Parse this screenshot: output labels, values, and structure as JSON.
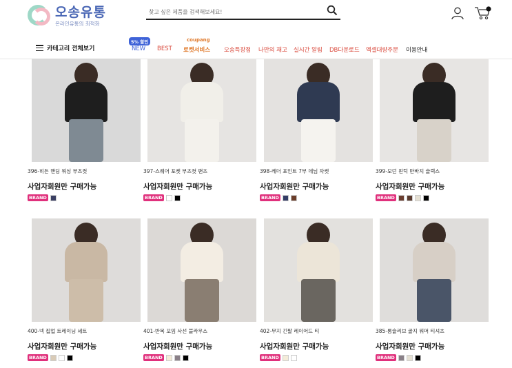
{
  "header": {
    "logo_title": "오송유통",
    "logo_subtitle": "온라인유통의 최적화",
    "search_placeholder": "찾고 싶은 제품을 검색해보세요!"
  },
  "nav": {
    "category_label": "카테고리 전체보기",
    "sale_badge": "5% 할인",
    "coupang_label": "coupang",
    "items": [
      "NEW",
      "BEST",
      "로켓서비스",
      "오송특장점",
      "나만의 재고",
      "실시간 알림",
      "DB다운로드",
      "엑셀대량주문",
      "이용안내"
    ]
  },
  "products": [
    {
      "name": "396-히든 밴딩 워싱 부츠컷",
      "price": "사업자회원만 구매가능",
      "brand": "BRAND",
      "swatches": [
        "#3a3f63"
      ],
      "bg": "#d9d9d9",
      "body": "#1e1e1e",
      "pants": "#7f8a93"
    },
    {
      "name": "397-스퀘어 포켓 부츠컷 팬츠",
      "price": "사업자회원만 구매가능",
      "brand": "BRAND",
      "swatches": [
        "#ffffff",
        "#000000"
      ],
      "bg": "#e6e4e2",
      "body": "#f1efe9",
      "pants": "#f3f1ec"
    },
    {
      "name": "398-레더 포인트 7부 데님 자켓",
      "price": "사업자회원만 구매가능",
      "brand": "BRAND",
      "swatches": [
        "#333d66",
        "#6a3d2a"
      ],
      "bg": "#e4e2e0",
      "body": "#2f3a52",
      "pants": "#f5f3ef"
    },
    {
      "name": "399-모던 핀턱 반바지 슬랙스",
      "price": "사업자회원만 구매가능",
      "brand": "BRAND",
      "swatches": [
        "#6a3d2f",
        "#5a3a2e",
        "#e5e0d3",
        "#000000"
      ],
      "bg": "#e7e5e3",
      "body": "#1e1e1e",
      "pants": "#d8d2c9"
    },
    {
      "name": "400-넥 집업 트레이닝 세트",
      "price": "사업자회원만 구매가능",
      "brand": "BRAND",
      "swatches": [
        "#d9cbb7",
        "#ffffff",
        "#000000"
      ],
      "bg": "#dedcda",
      "body": "#c9b8a4",
      "pants": "#cdbda9"
    },
    {
      "name": "401-반목 꼬임 사선 블라우스",
      "price": "사업자회원만 구매가능",
      "brand": "BRAND",
      "swatches": [
        "#f4ecd9",
        "#8a8088",
        "#000000"
      ],
      "bg": "#dcd9d6",
      "body": "#f3ede3",
      "pants": "#8a7e72"
    },
    {
      "name": "402-무지 긴팔 레이어드 티",
      "price": "사업자회원만 구매가능",
      "brand": "BRAND",
      "swatches": [
        "#f4ecd9",
        "#ffffff"
      ],
      "bg": "#e3e1de",
      "body": "#ece5d8",
      "pants": "#6a6660"
    },
    {
      "name": "385-롱슬리브 골지 워머 티셔츠",
      "price": "사업자회원만 구매가능",
      "brand": "BRAND",
      "swatches": [
        "#8a8088",
        "#e5e0d3",
        "#000000"
      ],
      "bg": "#dfdddb",
      "body": "#d7cfc6",
      "pants": "#4a5568"
    }
  ]
}
